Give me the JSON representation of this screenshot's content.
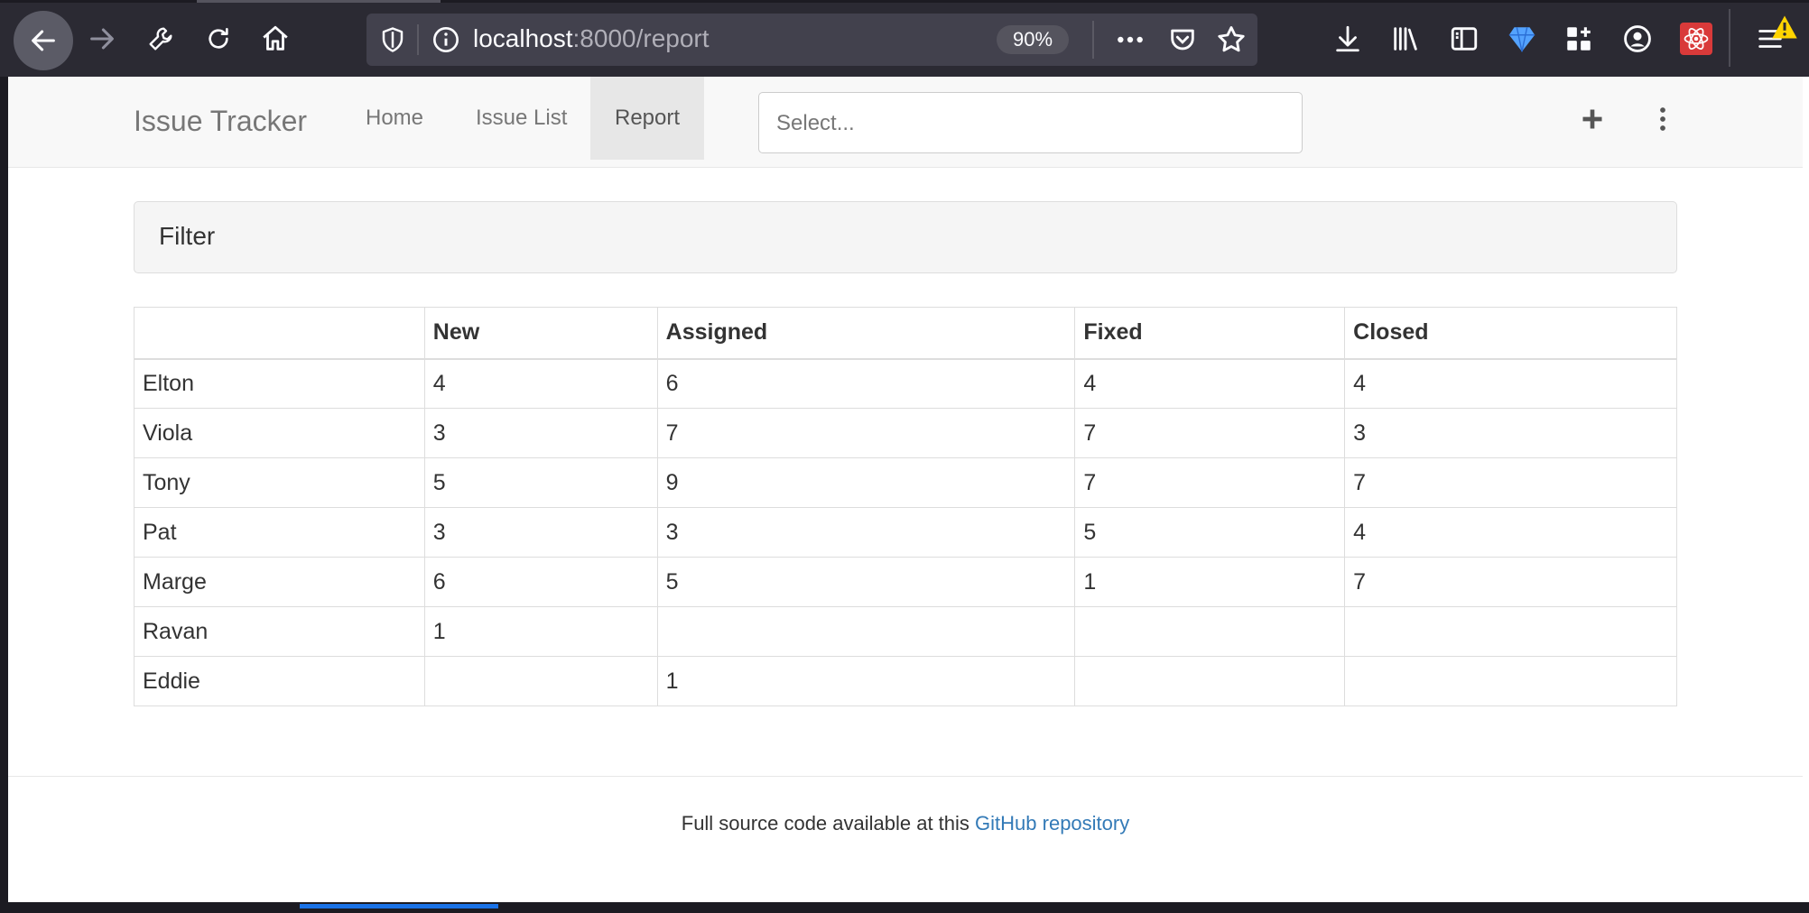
{
  "browser": {
    "url_host": "localhost",
    "url_path": ":8000/report",
    "zoom": "90%",
    "icons": {
      "back": "back-arrow-icon",
      "forward": "forward-arrow-icon",
      "tools": "wrench-icon",
      "reload": "reload-icon",
      "home": "home-icon",
      "shield": "tracking-shield-icon",
      "info": "site-info-icon",
      "more": "more-dots-icon",
      "pocket": "pocket-icon",
      "bookmark": "star-icon",
      "download": "download-icon",
      "library": "library-icon",
      "sidebar": "sidebar-icon",
      "gem": "gem-icon",
      "extensions": "extensions-icon",
      "account": "account-icon",
      "react": "react-devtools-icon",
      "menu": "hamburger-menu-icon"
    }
  },
  "navbar": {
    "brand": "Issue Tracker",
    "links": [
      "Home",
      "Issue List",
      "Report"
    ],
    "active": "Report",
    "select_placeholder": "Select...",
    "add_icon": "plus-icon",
    "menu_icon": "vertical-dots-icon"
  },
  "filter": {
    "title": "Filter"
  },
  "report": {
    "headers": [
      "",
      "New",
      "Assigned",
      "Fixed",
      "Closed"
    ],
    "rows": [
      [
        "Elton",
        "4",
        "6",
        "4",
        "4"
      ],
      [
        "Viola",
        "3",
        "7",
        "7",
        "3"
      ],
      [
        "Tony",
        "5",
        "9",
        "7",
        "7"
      ],
      [
        "Pat",
        "3",
        "3",
        "5",
        "4"
      ],
      [
        "Marge",
        "6",
        "5",
        "1",
        "7"
      ],
      [
        "Ravan",
        "1",
        "",
        "",
        ""
      ],
      [
        "Eddie",
        "",
        "1",
        "",
        ""
      ]
    ]
  },
  "footer": {
    "text": "Full source code available at this ",
    "link": "GitHub repository"
  },
  "colors": {
    "chrome_bg": "#2b2a33",
    "urlbar_bg": "#42414d",
    "link": "#337ab7",
    "navbar_bg": "#f8f8f8"
  }
}
